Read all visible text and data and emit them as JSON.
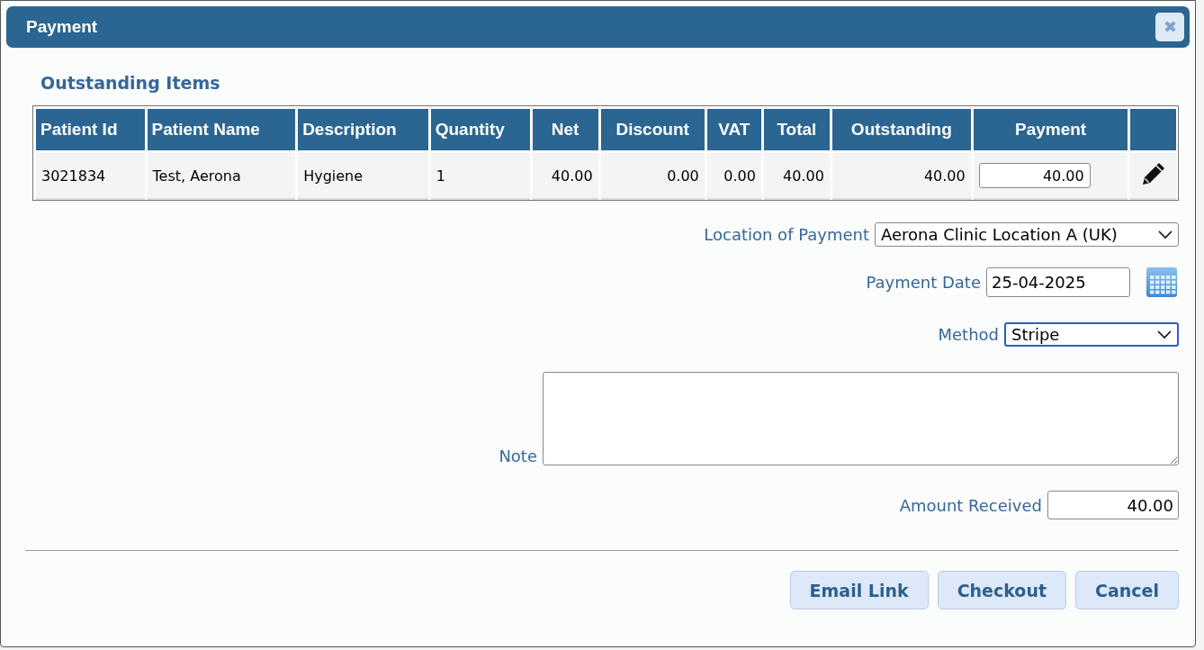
{
  "dialog": {
    "title": "Payment",
    "close_icon": "✖"
  },
  "section_title": "Outstanding Items",
  "table": {
    "columns": [
      {
        "label": "Patient Id",
        "kind": "text"
      },
      {
        "label": "Patient Name",
        "kind": "text"
      },
      {
        "label": "Description",
        "kind": "text"
      },
      {
        "label": "Quantity",
        "kind": "text"
      },
      {
        "label": "Net",
        "kind": "number"
      },
      {
        "label": "Discount",
        "kind": "number"
      },
      {
        "label": "VAT",
        "kind": "number"
      },
      {
        "label": "Total",
        "kind": "number"
      },
      {
        "label": "Outstanding",
        "kind": "number"
      },
      {
        "label": "Payment",
        "kind": "input"
      },
      {
        "kind": "action"
      }
    ],
    "rows": [
      {
        "cells": [
          "3021834",
          "Test, Aerona",
          "Hygiene",
          "1",
          "40.00",
          "0.00",
          "0.00",
          "40.00",
          "40.00"
        ],
        "payment": "40.00"
      }
    ]
  },
  "form": [
    {
      "kind": "select",
      "label": "Location of Payment",
      "value": "Aerona Clinic Location A (UK)",
      "focused": false
    },
    {
      "kind": "date",
      "label": "Payment Date",
      "value": "25-04-2025",
      "focused": false
    },
    {
      "kind": "select",
      "label": "Method",
      "value": "Stripe",
      "focused": true
    },
    {
      "kind": "textarea",
      "label": "Note",
      "focused": false
    },
    {
      "kind": "amount",
      "label": "Amount Received",
      "value": "40.00",
      "focused": false
    }
  ],
  "buttons": [
    "Email Link",
    "Checkout",
    "Cancel"
  ]
}
